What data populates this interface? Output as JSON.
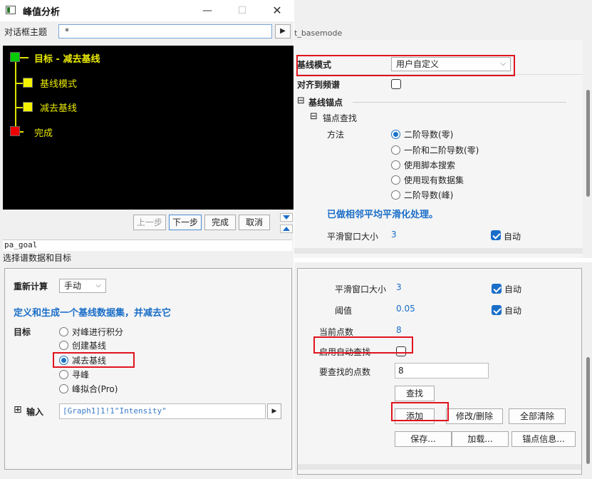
{
  "window": {
    "title": "峰值分析",
    "theme_label": "对话框主题",
    "theme_value": "*",
    "theme_go": "▶"
  },
  "tree": {
    "root": "目标 - 减去基线",
    "child1": "基线模式",
    "child2": "减去基线",
    "done": "完成"
  },
  "nav": {
    "prev": "上一步",
    "next": "下一步",
    "finish": "完成",
    "cancel": "取消"
  },
  "info": {
    "name": "pa_goal",
    "desc": "选择谱数据和目标"
  },
  "left_panel": {
    "recalc_label": "重新计算",
    "recalc_value": "手动",
    "heading": "定义和生成一个基线数据集，并减去它",
    "target_label": "目标",
    "targets": [
      "对峰进行积分",
      "创建基线",
      "减去基线",
      "寻峰",
      "峰拟合(Pro)"
    ],
    "selected_target": "减去基线",
    "input_label": "输入",
    "input_value": "[Graph1]1!1\"Intensity\"",
    "input_go": "▶"
  },
  "right_top": {
    "header_stub": "t_basemode",
    "baseline_mode_label": "基线模式",
    "baseline_mode_value": "用户自定义",
    "align_label": "对齐到频谱",
    "anchors_section": "基线锚点",
    "anchor_find_section": "锚点查找",
    "method_label": "方法",
    "methods": [
      "二阶导数(零)",
      "一阶和二阶导数(零)",
      "使用脚本搜索",
      "使用现有数据集",
      "二阶导数(峰)"
    ],
    "selected_method": "二阶导数(零)",
    "note": "已做相邻平均平滑化处理。",
    "smooth_label": "平滑窗口大小",
    "smooth_value": "3",
    "auto_label": "自动"
  },
  "right_bottom": {
    "smooth_label": "平滑窗口大小",
    "smooth_value": "3",
    "auto1_label": "自动",
    "threshold_label": "阈值",
    "threshold_value": "0.05",
    "auto2_label": "自动",
    "current_points_label": "当前点数",
    "current_points_value": "8",
    "enable_auto_label": "启用自动查找",
    "points_to_find_label": "要查找的点数",
    "points_to_find_value": "8",
    "find_btn": "查找",
    "add_btn": "添加",
    "modify_btn": "修改/删除",
    "clear_btn": "全部清除",
    "save_btn": "保存...",
    "load_btn": "加载...",
    "anchor_info_btn": "锚点信息..."
  },
  "colors": {
    "highlight": "#e0141e",
    "accent_blue": "#1a6ec8",
    "tree_text": "#e8e800",
    "node_green": "#00cc00",
    "node_yellow": "#f2f200",
    "node_red": "#ee0000"
  }
}
